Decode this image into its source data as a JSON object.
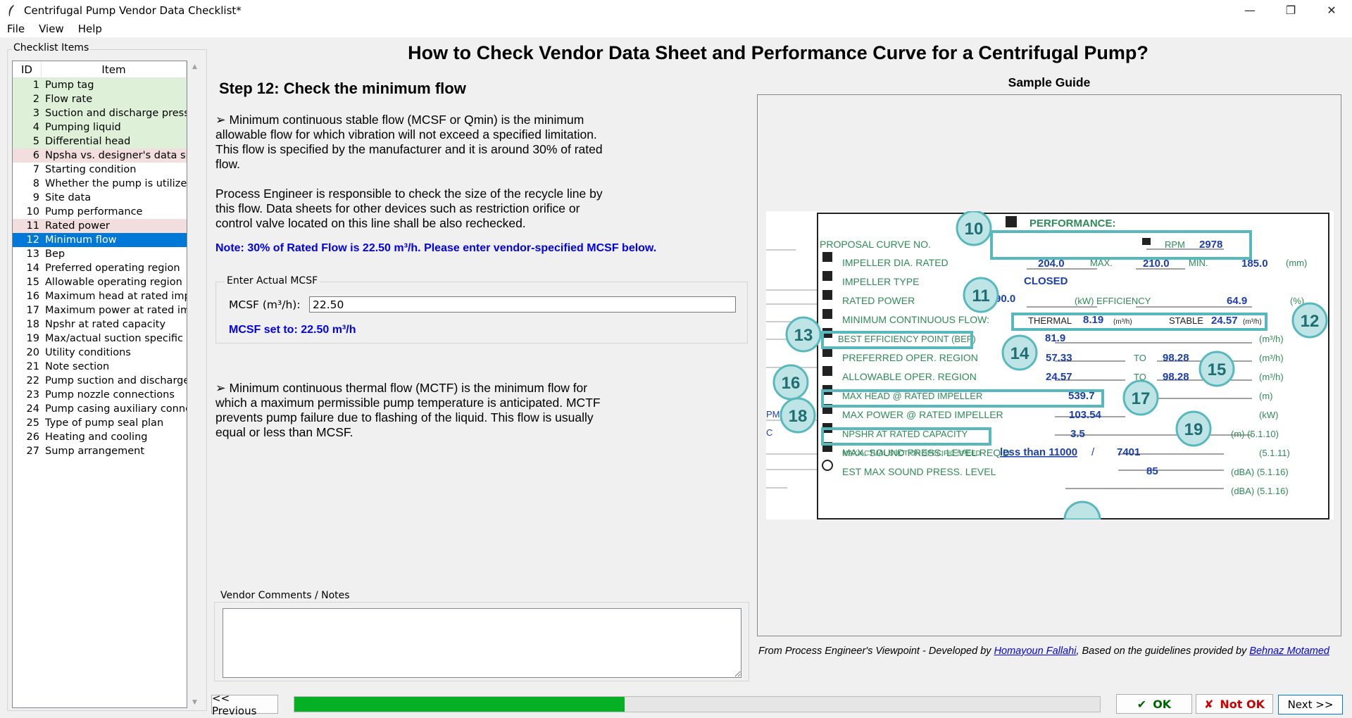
{
  "window": {
    "title": "Centrifugal Pump Vendor Data Checklist*",
    "minimize_glyph": "—",
    "restore_glyph": "❐",
    "close_glyph": "✕"
  },
  "menu": [
    "File",
    "View",
    "Help"
  ],
  "checklist": {
    "frame_label": "Checklist Items",
    "col_id": "ID",
    "col_item": "Item",
    "items": [
      {
        "id": "1",
        "label": "Pump tag",
        "status": "ok"
      },
      {
        "id": "2",
        "label": "Flow rate",
        "status": "ok"
      },
      {
        "id": "3",
        "label": "Suction and discharge pressure",
        "status": "ok"
      },
      {
        "id": "4",
        "label": "Pumping liquid",
        "status": "ok"
      },
      {
        "id": "5",
        "label": "Differential head",
        "status": "ok"
      },
      {
        "id": "6",
        "label": "Npsha vs. designer's data sheet",
        "status": "notok"
      },
      {
        "id": "7",
        "label": "Starting condition",
        "status": "none"
      },
      {
        "id": "8",
        "label": "Whether the pump is utilized continuously",
        "status": "none"
      },
      {
        "id": "9",
        "label": "Site data",
        "status": "none"
      },
      {
        "id": "10",
        "label": "Pump performance",
        "status": "none"
      },
      {
        "id": "11",
        "label": "Rated power",
        "status": "notok"
      },
      {
        "id": "12",
        "label": "Minimum flow",
        "status": "selected"
      },
      {
        "id": "13",
        "label": "Bep",
        "status": "none"
      },
      {
        "id": "14",
        "label": "Preferred operating region",
        "status": "none"
      },
      {
        "id": "15",
        "label": "Allowable operating region",
        "status": "none"
      },
      {
        "id": "16",
        "label": "Maximum head at rated impeller",
        "status": "none"
      },
      {
        "id": "17",
        "label": "Maximum power at rated impeller",
        "status": "none"
      },
      {
        "id": "18",
        "label": "Npshr at rated capacity",
        "status": "none"
      },
      {
        "id": "19",
        "label": "Max/actual suction specific speed",
        "status": "none"
      },
      {
        "id": "20",
        "label": "Utility conditions",
        "status": "none"
      },
      {
        "id": "21",
        "label": "Note section",
        "status": "none"
      },
      {
        "id": "22",
        "label": "Pump suction and discharge lines",
        "status": "none"
      },
      {
        "id": "23",
        "label": "Pump nozzle connections",
        "status": "none"
      },
      {
        "id": "24",
        "label": "Pump casing auxiliary connections",
        "status": "none"
      },
      {
        "id": "25",
        "label": "Type of pump seal plan",
        "status": "none"
      },
      {
        "id": "26",
        "label": "Heating and cooling",
        "status": "none"
      },
      {
        "id": "27",
        "label": "Sump arrangement",
        "status": "none"
      }
    ]
  },
  "main": {
    "title": "How to Check Vendor Data Sheet and Performance Curve for a Centrifugal Pump?",
    "step_title": "Step 12: Check the minimum flow",
    "para1": "➢ Minimum continuous stable flow (MCSF or Qmin) is the minimum allowable flow for which vibration will not exceed a specified limitation. This flow is specified by the manufacturer and it is around 30% of rated flow.",
    "para2": "Process Engineer is responsible to check the size of the recycle line by this flow. Data sheets for other devices such as restriction orifice or control valve located on this line shall be also rechecked.",
    "note": "Note: 30% of Rated Flow is 22.50 m³/h. Please enter vendor-specified MCSF below.",
    "mcsf_group_label": "Enter Actual MCSF",
    "mcsf_label": "MCSF (m³/h):",
    "mcsf_value": "22.50",
    "mcsf_set": "MCSF set to: 22.50 m³/h",
    "para3": "➢ Minimum continuous thermal flow (MCTF) is the minimum flow for which a maximum permissible pump temperature is anticipated. MCTF prevents pump failure due to flashing of the liquid. This flow is usually equal or less than MCSF.",
    "comments_label": "Vendor Comments / Notes"
  },
  "sample_guide": {
    "title": "Sample Guide",
    "sheet": {
      "heading": "PERFORMANCE:",
      "rows": {
        "proposal": "PROPOSAL CURVE NO.",
        "rpm_label": "RPM",
        "rpm": "2978",
        "impeller_dia": "IMPELLER DIA. RATED",
        "impeller_rated": "204.0",
        "max_label": "MAX.",
        "impeller_max": "210.0",
        "min_label": "MIN.",
        "impeller_min": "185.0",
        "mm": "(mm)",
        "impeller_type": "IMPELLER TYPE",
        "impeller_type_val": "CLOSED",
        "rated_power": "RATED POWER",
        "rated_power_val": "90.0",
        "kw_eff": "(kW)  EFFICIENCY",
        "efficiency": "64.9",
        "pct": "(%)",
        "min_cont_flow": "MINIMUM CONTINUOUS FLOW:",
        "thermal_label": "THERMAL",
        "thermal": "8.19",
        "thermal_unit": "(m³/h)",
        "stable_label": "STABLE",
        "stable": "24.57",
        "stable_unit": "(m³/h)",
        "bep": "BEST EFFICIENCY POINT (BEP)",
        "bep_val": "81.9",
        "m3h": "(m³/h)",
        "preferred": "PREFERRED OPER. REGION",
        "preferred_from": "57.33",
        "to": "TO",
        "preferred_to": "98.28",
        "allowable": "ALLOWABLE OPER. REGION",
        "allowable_from": "24.57",
        "allowable_to": "98.28",
        "max_head": "MAX HEAD @ RATED IMPELLER",
        "max_head_val": "539.7",
        "m_unit": "(m)",
        "max_power": "MAX POWER @ RATED IMPELLER",
        "max_power_val": "103.54",
        "kw_unit": "(kW)",
        "npshr": "NPSHR AT RATED CAPACITY",
        "npshr_val": "3.5",
        "npshr_ref": "(m) (5.1.10)",
        "suction_speed": "MAX/ACTUAL SUCTION SPECIFIC SPEED",
        "suction_speed_max": "less than 11000",
        "slash": "/",
        "suction_speed_act": "7401",
        "ss_ref": "(5.1.11)",
        "sound": "MAX. SOUND PRESS. LEVEL REQ'D",
        "sound_val": "85",
        "sound_ref": "(dBA) (5.1.16)",
        "est_sound": "EST MAX SOUND PRESS. LEVEL",
        "est_ref": "(dBA) (5.1.16)",
        "edge_pm": "PM)",
        "edge_c": "C"
      },
      "markers": [
        "10",
        "11",
        "12",
        "13",
        "14",
        "15",
        "16",
        "17",
        "18",
        "19"
      ]
    },
    "credit_prefix": "From Process Engineer's Viewpoint - Developed by ",
    "credit_author": "Homayoun Fallahi",
    "credit_mid": ", Based on the guidelines provided by ",
    "credit_ref": "Behnaz Motamed"
  },
  "footer": {
    "prev": "<< Previous",
    "progress": 0.41,
    "ok_mark": "✔",
    "ok": "OK",
    "notok_mark": "✘",
    "notok": "Not OK",
    "next": "Next >>"
  },
  "colors": {
    "ok_row": "#dff0d8",
    "notok_row": "#f2dede",
    "selected_row": "#0078d7",
    "sheet_green": "#2e8b57",
    "sheet_blue": "#1c3fae",
    "marker_teal": "#57b9bd",
    "progress_fill": "#06b025"
  }
}
